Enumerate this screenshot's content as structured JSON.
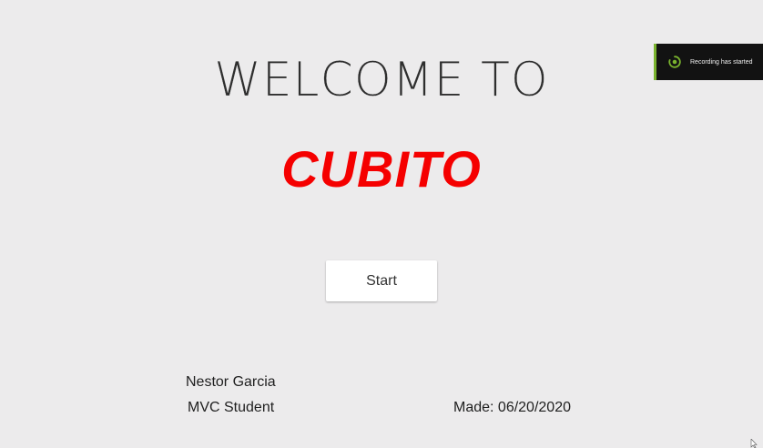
{
  "main": {
    "welcome_text": "WELCOME TO",
    "brand_text": "CUBITO",
    "start_label": "Start"
  },
  "footer": {
    "author_name": "Nestor Garcia",
    "author_role": "MVC Student",
    "made_date": "Made: 06/20/2020"
  },
  "toast": {
    "message": "Recording has started",
    "icon": "recording-icon"
  },
  "colors": {
    "background": "#ecebec",
    "brand": "#f50000",
    "toast_accent": "#7ab32e",
    "toast_background": "#121212"
  }
}
